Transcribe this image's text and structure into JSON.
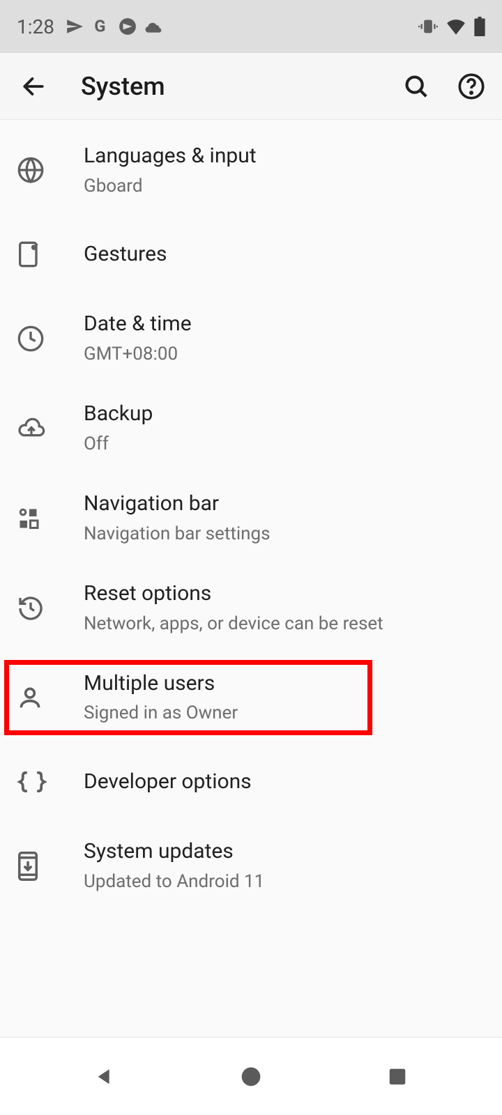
{
  "status": {
    "time": "1:28"
  },
  "header": {
    "title": "System"
  },
  "items": [
    {
      "title": "Languages & input",
      "subtitle": "Gboard"
    },
    {
      "title": "Gestures",
      "subtitle": ""
    },
    {
      "title": "Date & time",
      "subtitle": "GMT+08:00"
    },
    {
      "title": "Backup",
      "subtitle": "Off"
    },
    {
      "title": "Navigation bar",
      "subtitle": "Navigation bar settings"
    },
    {
      "title": "Reset options",
      "subtitle": "Network, apps, or device can be reset"
    },
    {
      "title": "Multiple users",
      "subtitle": "Signed in as Owner"
    },
    {
      "title": "Developer options",
      "subtitle": ""
    },
    {
      "title": "System updates",
      "subtitle": "Updated to Android 11"
    }
  ]
}
